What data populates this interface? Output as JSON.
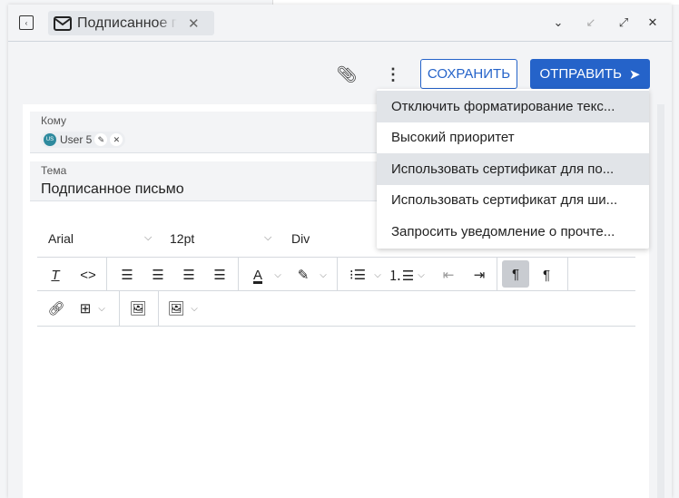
{
  "tab": {
    "title": "Подписанное письмо",
    "icon": "envelope-icon"
  },
  "window_controls": [
    "chevron-down-icon",
    "minimize-icon",
    "maximize-icon",
    "close-icon"
  ],
  "actions": {
    "save": "СОХРАНИТЬ",
    "send": "ОТПРАВИТЬ"
  },
  "to": {
    "label": "Кому",
    "recipient": "User 5",
    "initials": "US"
  },
  "subject": {
    "label": "Тема",
    "value": "Подписанное письмо"
  },
  "editor": {
    "font": "Arial",
    "size": "12pt",
    "block": "Div"
  },
  "menu": {
    "items": [
      {
        "label": "Отключить форматирование текс...",
        "highlighted": true
      },
      {
        "label": "Высокий приоритет",
        "highlighted": false
      },
      {
        "label": "Использовать сертификат для по...",
        "highlighted": true
      },
      {
        "label": "Использовать сертификат для ши...",
        "highlighted": false
      },
      {
        "label": "Запросить уведомление о прочте...",
        "highlighted": false
      }
    ]
  },
  "colors": {
    "accent": "#2563c9",
    "avatar": "#2e8a9e"
  }
}
